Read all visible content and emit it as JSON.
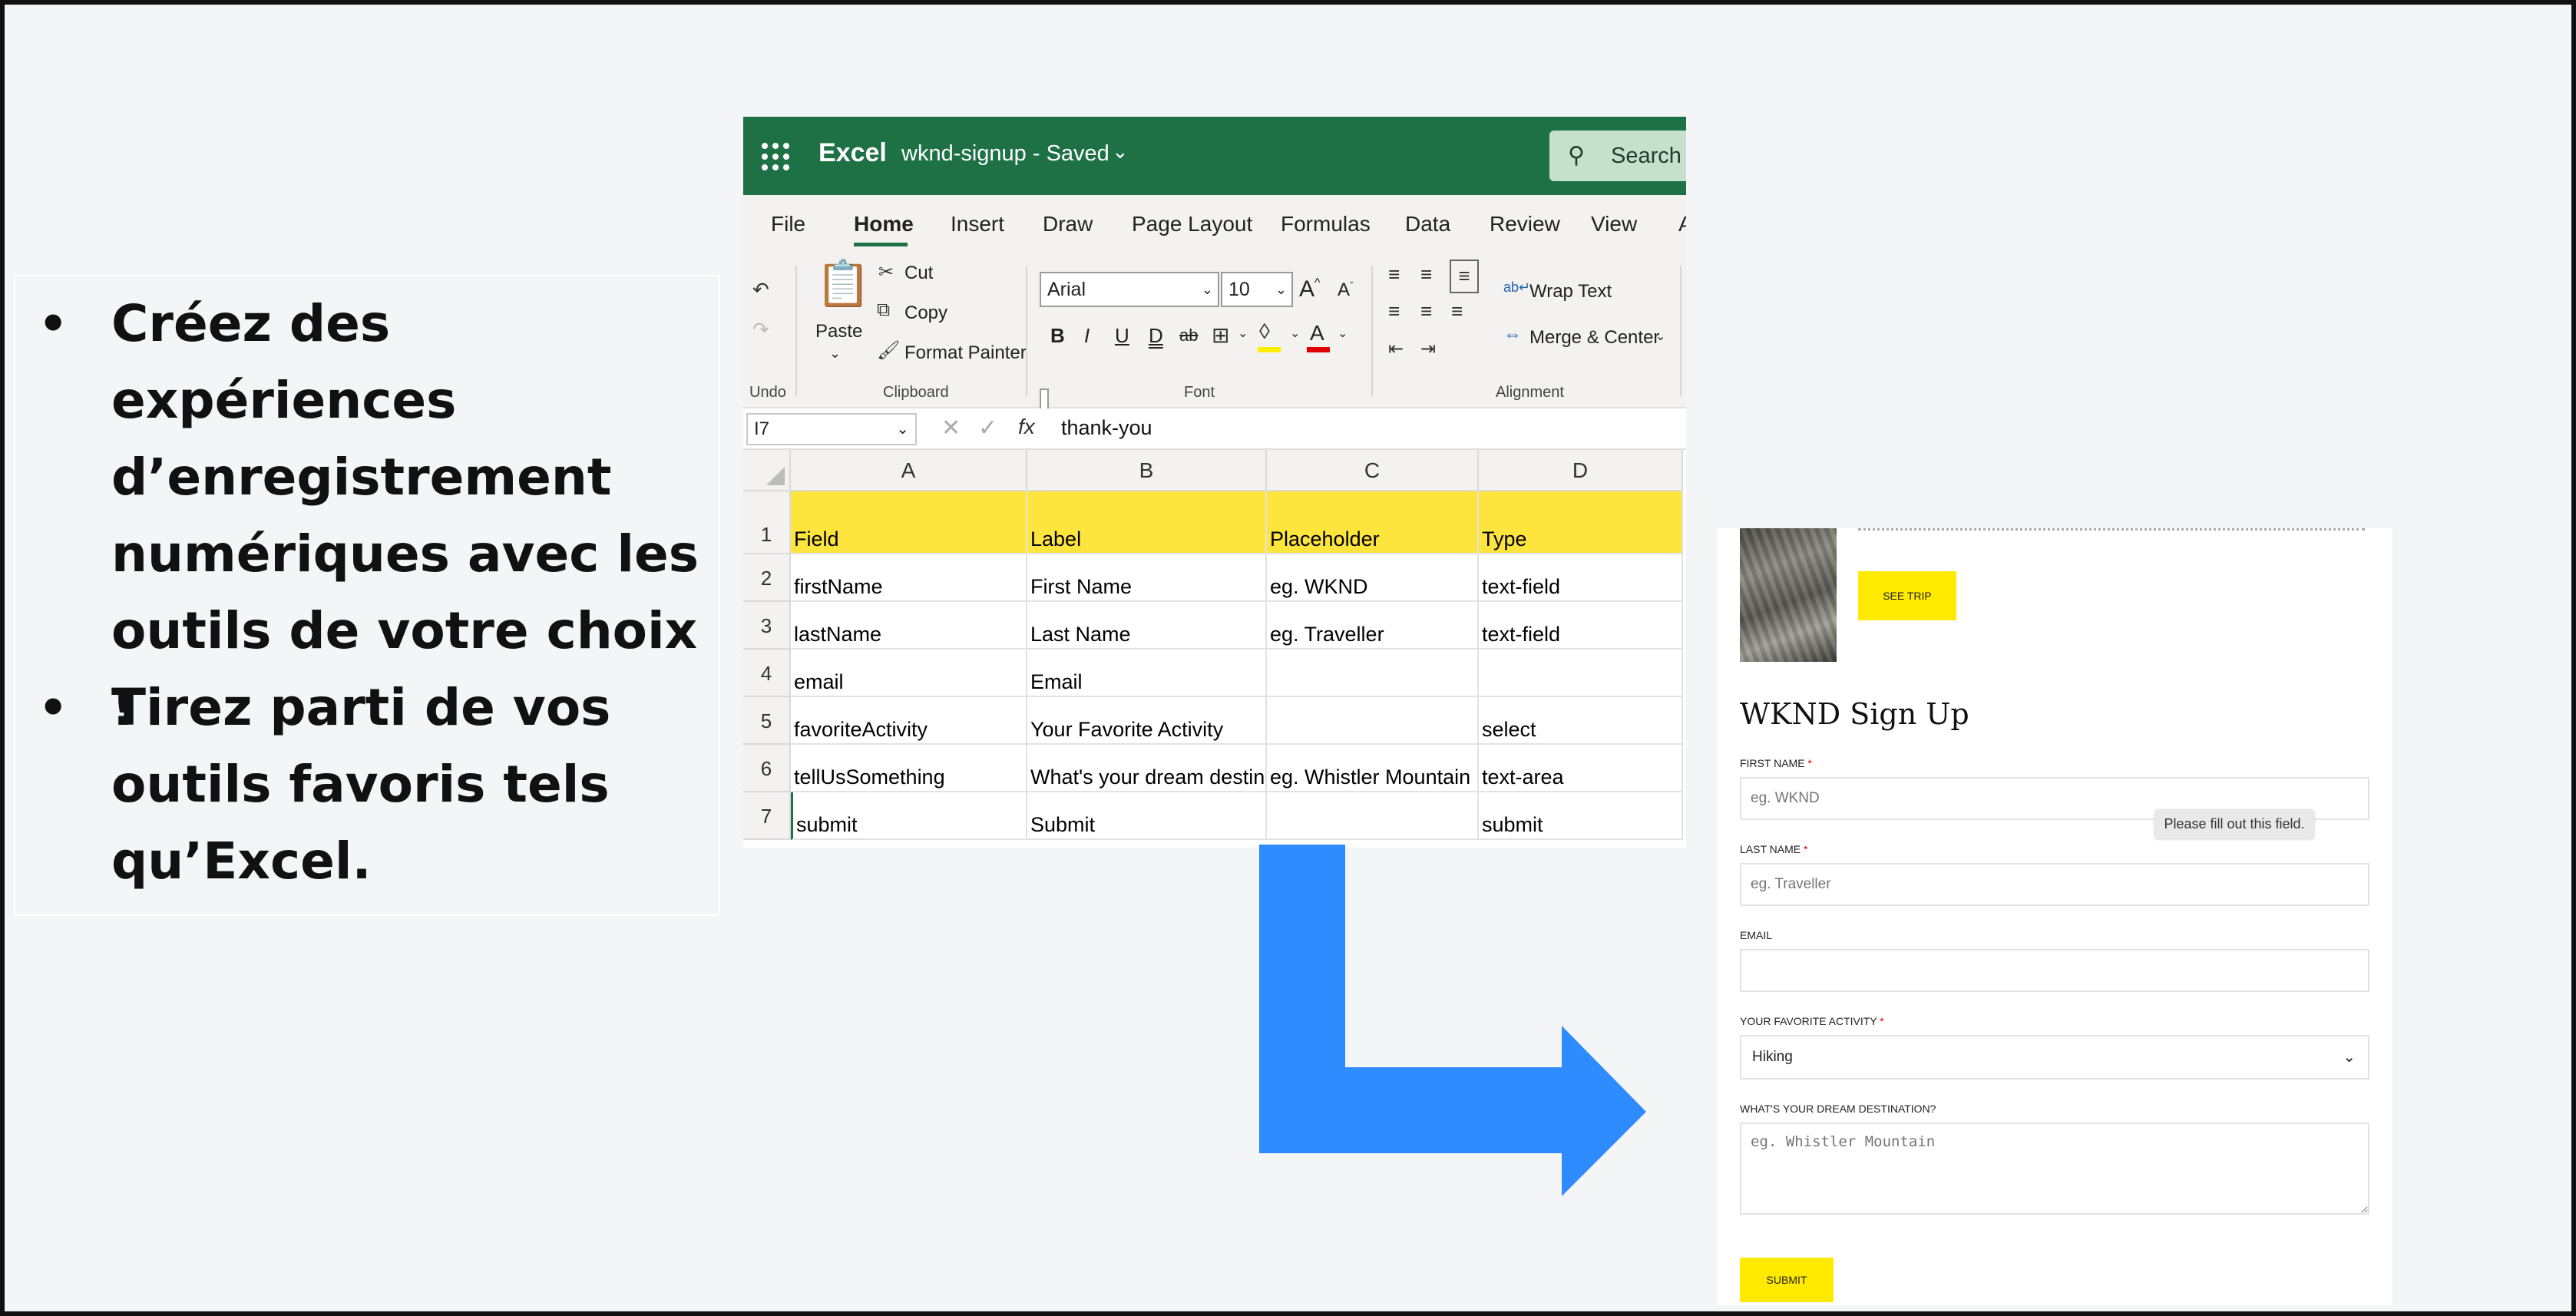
{
  "bullets": [
    "Créez des expériences d’enregistrement numériques avec les outils de votre choix !",
    "Tirez parti de vos outils favoris tels qu’Excel."
  ],
  "bullet_symbol": "•",
  "excel": {
    "app_name": "Excel",
    "doc_title": "wknd-signup  -  Saved",
    "search_label": "Search (",
    "title_bar_color": "#1e7145",
    "tabs": [
      "File",
      "Home",
      "Insert",
      "Draw",
      "Page Layout",
      "Formulas",
      "Data",
      "Review",
      "View",
      "A"
    ],
    "active_tab": "Home",
    "ribbon": {
      "undo_group": "Undo",
      "paste": "Paste",
      "cut": "Cut",
      "copy": "Copy",
      "format_painter": "Format Painter",
      "clipboard_group": "Clipboard",
      "font_name": "Arial",
      "font_size": "10",
      "font_group": "Font",
      "bold": "B",
      "italic": "I",
      "underline": "U",
      "double_underline": "D",
      "strike": "ab",
      "font_color": "A",
      "grow": "A",
      "shrink": "A",
      "wrap_text": "Wrap Text",
      "merge_center": "Merge & Center",
      "alignment_group": "Alignment"
    },
    "name_box": "I7",
    "formula_value": "thank-you",
    "columns": [
      "A",
      "B",
      "C",
      "D"
    ],
    "rows": [
      "1",
      "2",
      "3",
      "4",
      "5",
      "6",
      "7"
    ],
    "cells": [
      [
        "Field",
        "Label",
        "Placeholder",
        "Type"
      ],
      [
        "firstName",
        "First Name",
        "eg. WKND",
        "text-field"
      ],
      [
        "lastName",
        "Last Name",
        "eg. Traveller",
        "text-field"
      ],
      [
        "email",
        "Email",
        "",
        ""
      ],
      [
        "favoriteActivity",
        "Your Favorite Activity",
        "",
        "select"
      ],
      [
        "tellUsSomething",
        "What's your dream destination?",
        "eg. Whistler Mountain",
        "text-area"
      ],
      [
        "submit",
        "Submit",
        "",
        "submit"
      ]
    ],
    "header_row_color": "#fde53d"
  },
  "arrow_color": "#2f8cff",
  "form": {
    "see_trip": "SEE TRIP",
    "title": "WKND Sign Up",
    "required_mark": "*",
    "first_name_label": "FIRST NAME",
    "first_name_placeholder": "eg. WKND",
    "tooltip": "Please fill out this field.",
    "last_name_label": "LAST NAME",
    "last_name_placeholder": "eg. Traveller",
    "email_label": "EMAIL",
    "activity_label": "YOUR FAVORITE ACTIVITY",
    "activity_value": "Hiking",
    "destination_label": "WHAT'S YOUR DREAM DESTINATION?",
    "destination_placeholder": "eg. Whistler Mountain",
    "submit_label": "SUBMIT",
    "accent_color": "#ffea00"
  }
}
